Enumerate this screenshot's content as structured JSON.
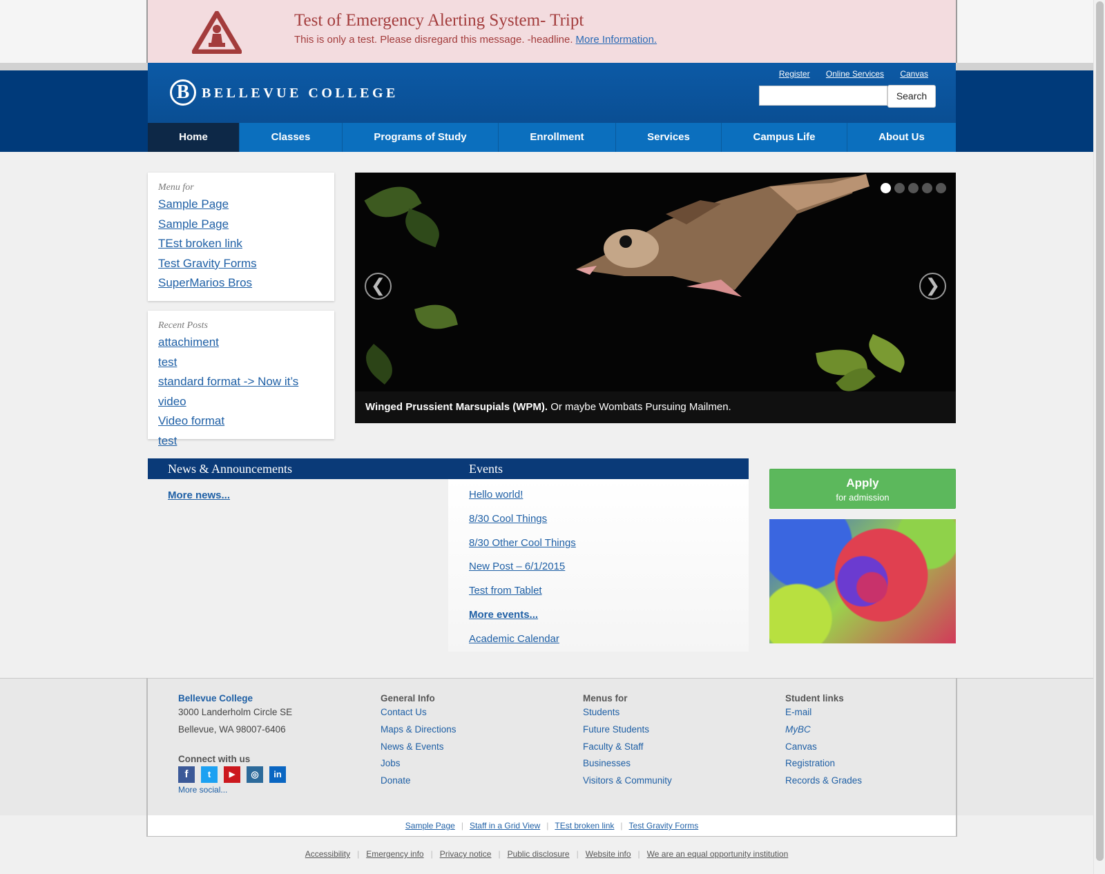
{
  "alert": {
    "title": "Test of Emergency Alerting System- Tript",
    "text": "This is only a test. Please disregard this message. -headline.",
    "link": "More Information."
  },
  "header": {
    "logo_letter": "B",
    "logo_text": "BELLEVUE COLLEGE",
    "links": [
      "Register",
      "Online Services",
      "Canvas"
    ],
    "search_placeholder": "",
    "search_button": "Search"
  },
  "nav": [
    {
      "label": "Home",
      "active": true
    },
    {
      "label": "Classes"
    },
    {
      "label": "Programs of Study"
    },
    {
      "label": "Enrollment"
    },
    {
      "label": "Services"
    },
    {
      "label": "Campus Life"
    },
    {
      "label": "About Us"
    }
  ],
  "menu_box": {
    "heading": "Menu for",
    "items": [
      "Sample Page",
      "Sample Page",
      "TEst broken link",
      "Test Gravity Forms",
      "SuperMarios Bros"
    ]
  },
  "recent_posts": {
    "heading": "Recent Posts",
    "items": [
      "attachiment",
      "test",
      "standard format -> Now it’s video",
      "Video format",
      "test"
    ]
  },
  "slider": {
    "caption_bold": "Winged Prussient Marsupials (WPM).",
    "caption_rest": " Or maybe Wombats Pursuing Mailmen.",
    "prev": "❮",
    "next": "❯",
    "dot_count": 5,
    "active_dot": 0
  },
  "news": {
    "heading": "News & Announcements",
    "more": "More news..."
  },
  "events": {
    "heading": "Events",
    "items": [
      "Hello world!",
      "8/30 Cool Things",
      "8/30 Other Cool Things",
      "New Post – 6/1/2015",
      "Test from Tablet"
    ],
    "more": "More events...",
    "calendar": "Academic Calendar"
  },
  "apply": {
    "title": "Apply",
    "subtitle": "for admission"
  },
  "footer": {
    "college": {
      "name": "Bellevue College",
      "address1": "3000 Landerholm Circle SE",
      "address2": "Bellevue, WA 98007-6406"
    },
    "connect": "Connect with us",
    "more_social": "More social...",
    "general": {
      "heading": "General Info",
      "items": [
        "Contact Us",
        "Maps & Directions",
        "News & Events",
        "Jobs",
        "Donate"
      ]
    },
    "menus_for": {
      "heading": "Menus for",
      "items": [
        "Students",
        "Future Students",
        "Faculty & Staff",
        "Businesses",
        "Visitors & Community"
      ]
    },
    "student_links": {
      "heading": "Student links",
      "items": [
        "E-mail",
        "MyBC",
        "Canvas",
        "Registration",
        "Records & Grades"
      ]
    },
    "strip_links": [
      "Sample Page",
      "Staff in a Grid View",
      "TEst broken link",
      "Test Gravity Forms"
    ],
    "bottom_links": [
      "Accessibility",
      "Emergency info",
      "Privacy notice",
      "Public disclosure",
      "Website info",
      "We are an equal opportunity institution"
    ]
  },
  "colors": {
    "brand_blue": "#0a3a78",
    "nav_blue": "#0b6fbe",
    "alert_bg": "#f3dcdf",
    "alert_red": "#a33c3c",
    "apply_green": "#5cb85c"
  }
}
